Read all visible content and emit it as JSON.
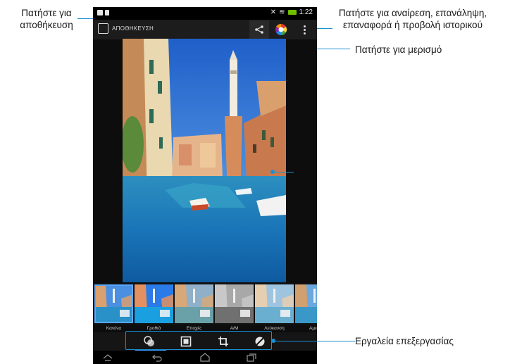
{
  "callouts": {
    "save": [
      "Πατήστε για",
      "αποθήκευση"
    ],
    "more": [
      "Πατήστε για αναίρεση, επανάληψη,",
      "επαναφορά ή προβολή ιστορικού"
    ],
    "share": "Πατήστε για μερισμό",
    "tools": "Εργαλεία επεξεργασίας"
  },
  "status_bar": {
    "time": "1:22",
    "battery_color": "#6cc000"
  },
  "action_bar": {
    "save_label": "ΑΠΟΘΗΚΕΥΣΗ",
    "save_icon": "save-icon",
    "share_icon": "share-icon",
    "color_icon": "color-wheel-icon",
    "more_icon": "more-vertical-icon"
  },
  "filters": [
    {
      "label": "Κανένα",
      "style": "color",
      "selected": true
    },
    {
      "label": "Γροθιά",
      "style": "vivid",
      "selected": false
    },
    {
      "label": "Εποχές",
      "style": "warm",
      "selected": false
    },
    {
      "label": "Α/Μ",
      "style": "bw",
      "selected": false
    },
    {
      "label": "Λεύκανση",
      "style": "bleach",
      "selected": false
    },
    {
      "label": "Αμεσ",
      "style": "instant",
      "selected": false
    }
  ],
  "tools": [
    {
      "name": "filters-tool",
      "icon": "filter-circles-icon",
      "active": true
    },
    {
      "name": "border-tool",
      "icon": "frame-icon",
      "active": false
    },
    {
      "name": "crop-tool",
      "icon": "crop-icon",
      "active": false
    },
    {
      "name": "adjust-tool",
      "icon": "adjust-icon",
      "active": false
    }
  ],
  "nav_bar": [
    "home-up-icon",
    "back-icon",
    "home-icon",
    "recents-icon"
  ],
  "colors": {
    "accent": "#1a8fd6",
    "selection": "#5aa7ff"
  }
}
